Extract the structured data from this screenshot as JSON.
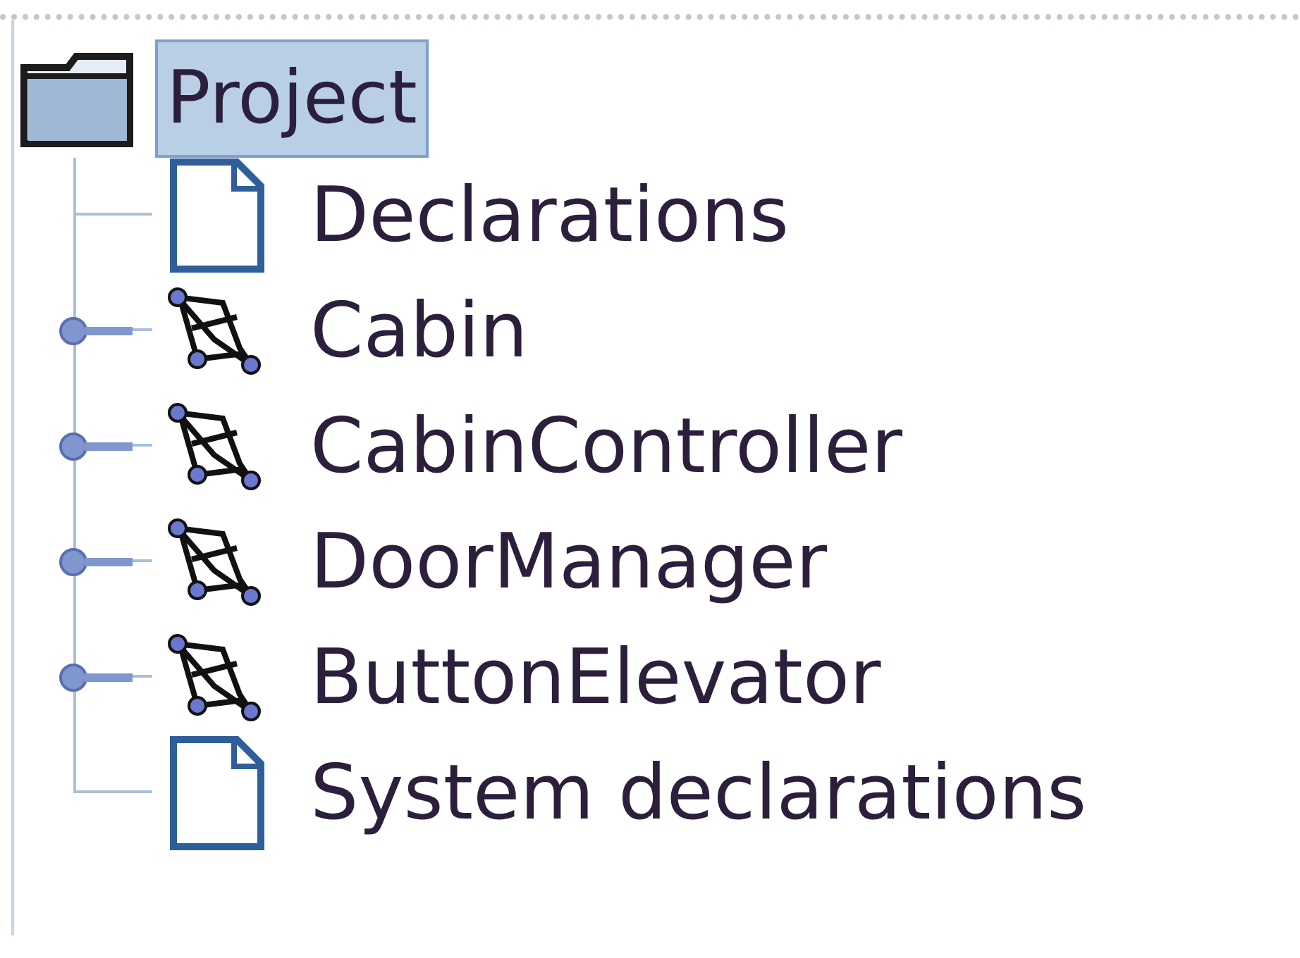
{
  "tree": {
    "label": "Project",
    "selected": true,
    "children": [
      {
        "label": "Declarations",
        "kind": "declarations",
        "selected": false
      },
      {
        "label": "Cabin",
        "kind": "template",
        "selected": false
      },
      {
        "label": "CabinController",
        "kind": "template",
        "selected": false
      },
      {
        "label": "DoorManager",
        "kind": "template",
        "selected": false
      },
      {
        "label": "ButtonElevator",
        "kind": "template",
        "selected": false
      },
      {
        "label": "System declarations",
        "kind": "declarations",
        "selected": false
      }
    ]
  }
}
